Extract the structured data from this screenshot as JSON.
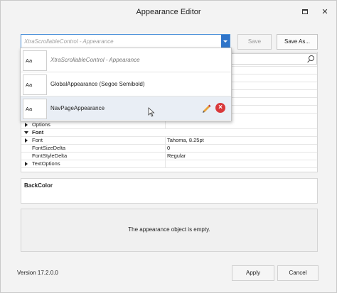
{
  "window": {
    "title": "Appearance Editor"
  },
  "toolbar": {
    "combo_placeholder": "XtraScrollableControl - Appearance",
    "save_label": "Save",
    "save_as_label": "Save As..."
  },
  "dropdown": {
    "items": [
      {
        "swatch": "Aa",
        "label": "XtraScrollableControl - Appearance"
      },
      {
        "swatch": "Aa",
        "label": "GlobalAppearance (Segoe Semibold)"
      },
      {
        "swatch": "Aa",
        "label": "NavPageAppearance"
      }
    ]
  },
  "properties": {
    "options": "Options",
    "font_category": "Font",
    "font_name": "Font",
    "font_value": "Tahoma, 8.25pt",
    "font_size_delta_name": "FontSizeDelta",
    "font_size_delta_value": "0",
    "font_style_delta_name": "FontStyleDelta",
    "font_style_delta_value": "Regular",
    "text_options": "TextOptions"
  },
  "backcolor": {
    "label": "BackColor"
  },
  "preview": {
    "message": "The appearance object is empty."
  },
  "footer": {
    "version": "Version 17.2.0.0",
    "apply_label": "Apply",
    "cancel_label": "Cancel"
  },
  "colors": {
    "accent": "#2f74c9",
    "delete": "#d9383a"
  }
}
